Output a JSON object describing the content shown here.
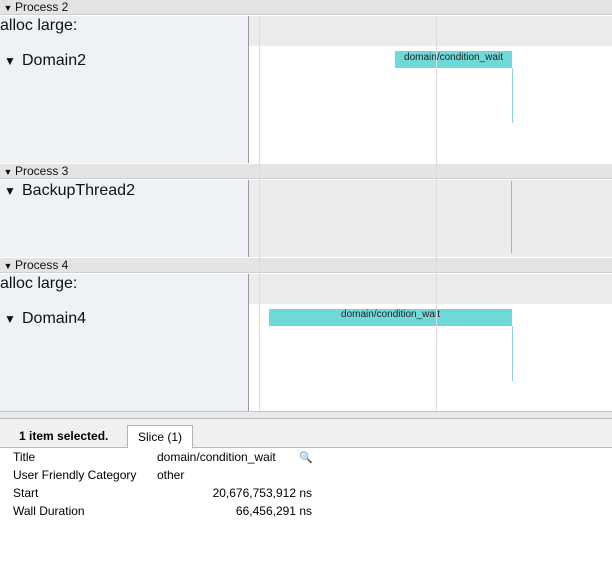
{
  "processes": [
    {
      "title": "Process 2",
      "alloc_label": "alloc large:",
      "thread_label": "Domain2",
      "slice": {
        "label": "domain/condition_wait"
      }
    },
    {
      "title": "Process 3",
      "thread_label": "BackupThread2"
    },
    {
      "title": "Process 4",
      "alloc_label": "alloc large:",
      "thread_label": "Domain4",
      "slice": {
        "label": "domain/condition_wait"
      }
    }
  ],
  "selection": {
    "summary": "1 item selected.",
    "tab_label": "Slice (1)"
  },
  "details": {
    "rows": [
      {
        "label": "Title",
        "value": "domain/condition_wait"
      },
      {
        "label": "User Friendly Category",
        "value": "other"
      },
      {
        "label": "Start",
        "value": "20,676,753,912 ns"
      },
      {
        "label": "Wall Duration",
        "value": "66,456,291 ns"
      }
    ]
  },
  "icons": {
    "expand": "▼",
    "search": "🔍"
  },
  "colors": {
    "slice": "#6fd9d9",
    "header": "#e4e4e4",
    "left_column": "#eef2f6"
  }
}
